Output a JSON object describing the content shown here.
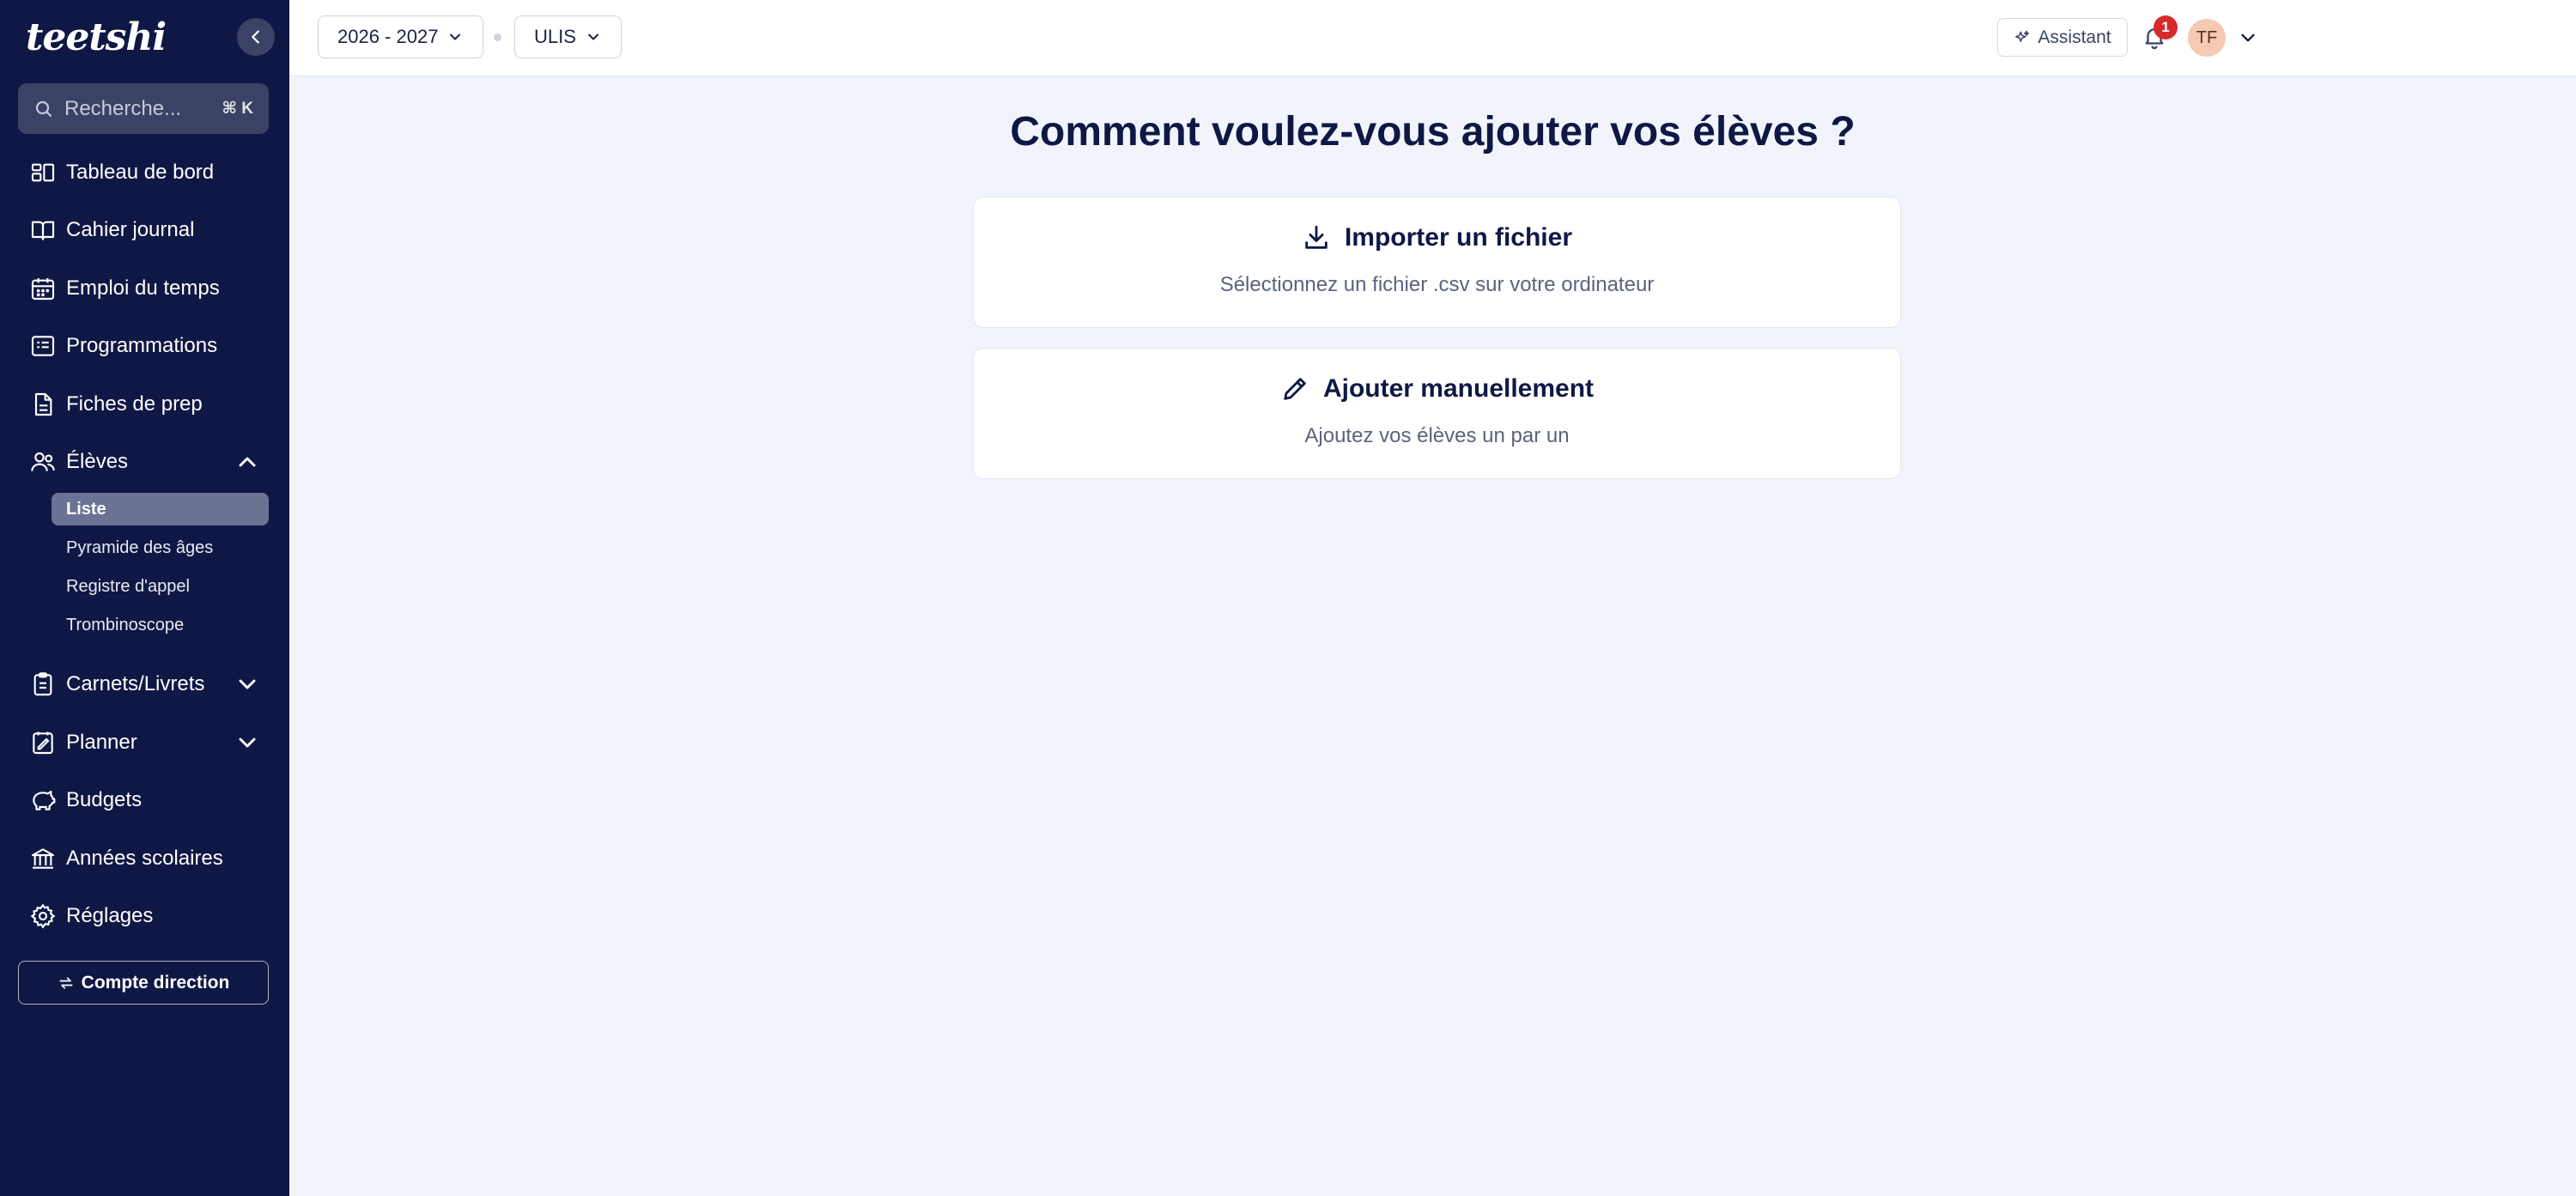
{
  "app": {
    "logo_text": "teetshi",
    "search": {
      "placeholder": "Recherche...",
      "shortcut": "⌘ K"
    }
  },
  "sidebar": {
    "items": [
      {
        "label": "Tableau de bord",
        "icon": "dashboard-icon"
      },
      {
        "label": "Cahier journal",
        "icon": "book-icon"
      },
      {
        "label": "Emploi du temps",
        "icon": "calendar-icon"
      },
      {
        "label": "Programmations",
        "icon": "list-icon"
      },
      {
        "label": "Fiches de prep",
        "icon": "document-icon"
      },
      {
        "label": "Élèves",
        "icon": "users-icon",
        "expanded": true
      },
      {
        "label": "Carnets/Livrets",
        "icon": "clipboard-icon",
        "expanded": false
      },
      {
        "label": "Planner",
        "icon": "planner-icon",
        "expanded": false
      },
      {
        "label": "Budgets",
        "icon": "piggy-bank-icon"
      },
      {
        "label": "Années scolaires",
        "icon": "school-icon"
      },
      {
        "label": "Réglages",
        "icon": "gear-icon"
      }
    ],
    "eleves_sub": [
      {
        "label": "Liste",
        "active": true
      },
      {
        "label": "Pyramide des âges"
      },
      {
        "label": "Registre d'appel"
      },
      {
        "label": "Trombinoscope"
      }
    ],
    "direction_button": "Compte direction"
  },
  "topbar": {
    "year_select": "2026 - 2027",
    "class_select": "ULIS",
    "assistant_label": "Assistant",
    "notification_count": "1",
    "avatar_initials": "TF"
  },
  "main": {
    "title": "Comment voulez-vous ajouter vos élèves ?",
    "options": [
      {
        "title": "Importer un fichier",
        "subtitle": "Sélectionnez un fichier .csv sur votre ordinateur",
        "icon": "download-icon"
      },
      {
        "title": "Ajouter manuellement",
        "subtitle": "Ajoutez vos élèves un par un",
        "icon": "pencil-icon"
      }
    ]
  },
  "colors": {
    "sidebar_bg": "#0f1845",
    "active_sub_bg": "#6b7293",
    "page_bg": "#f1f4fa",
    "badge": "#d62b2b",
    "avatar_bg": "#f6c9b3"
  }
}
